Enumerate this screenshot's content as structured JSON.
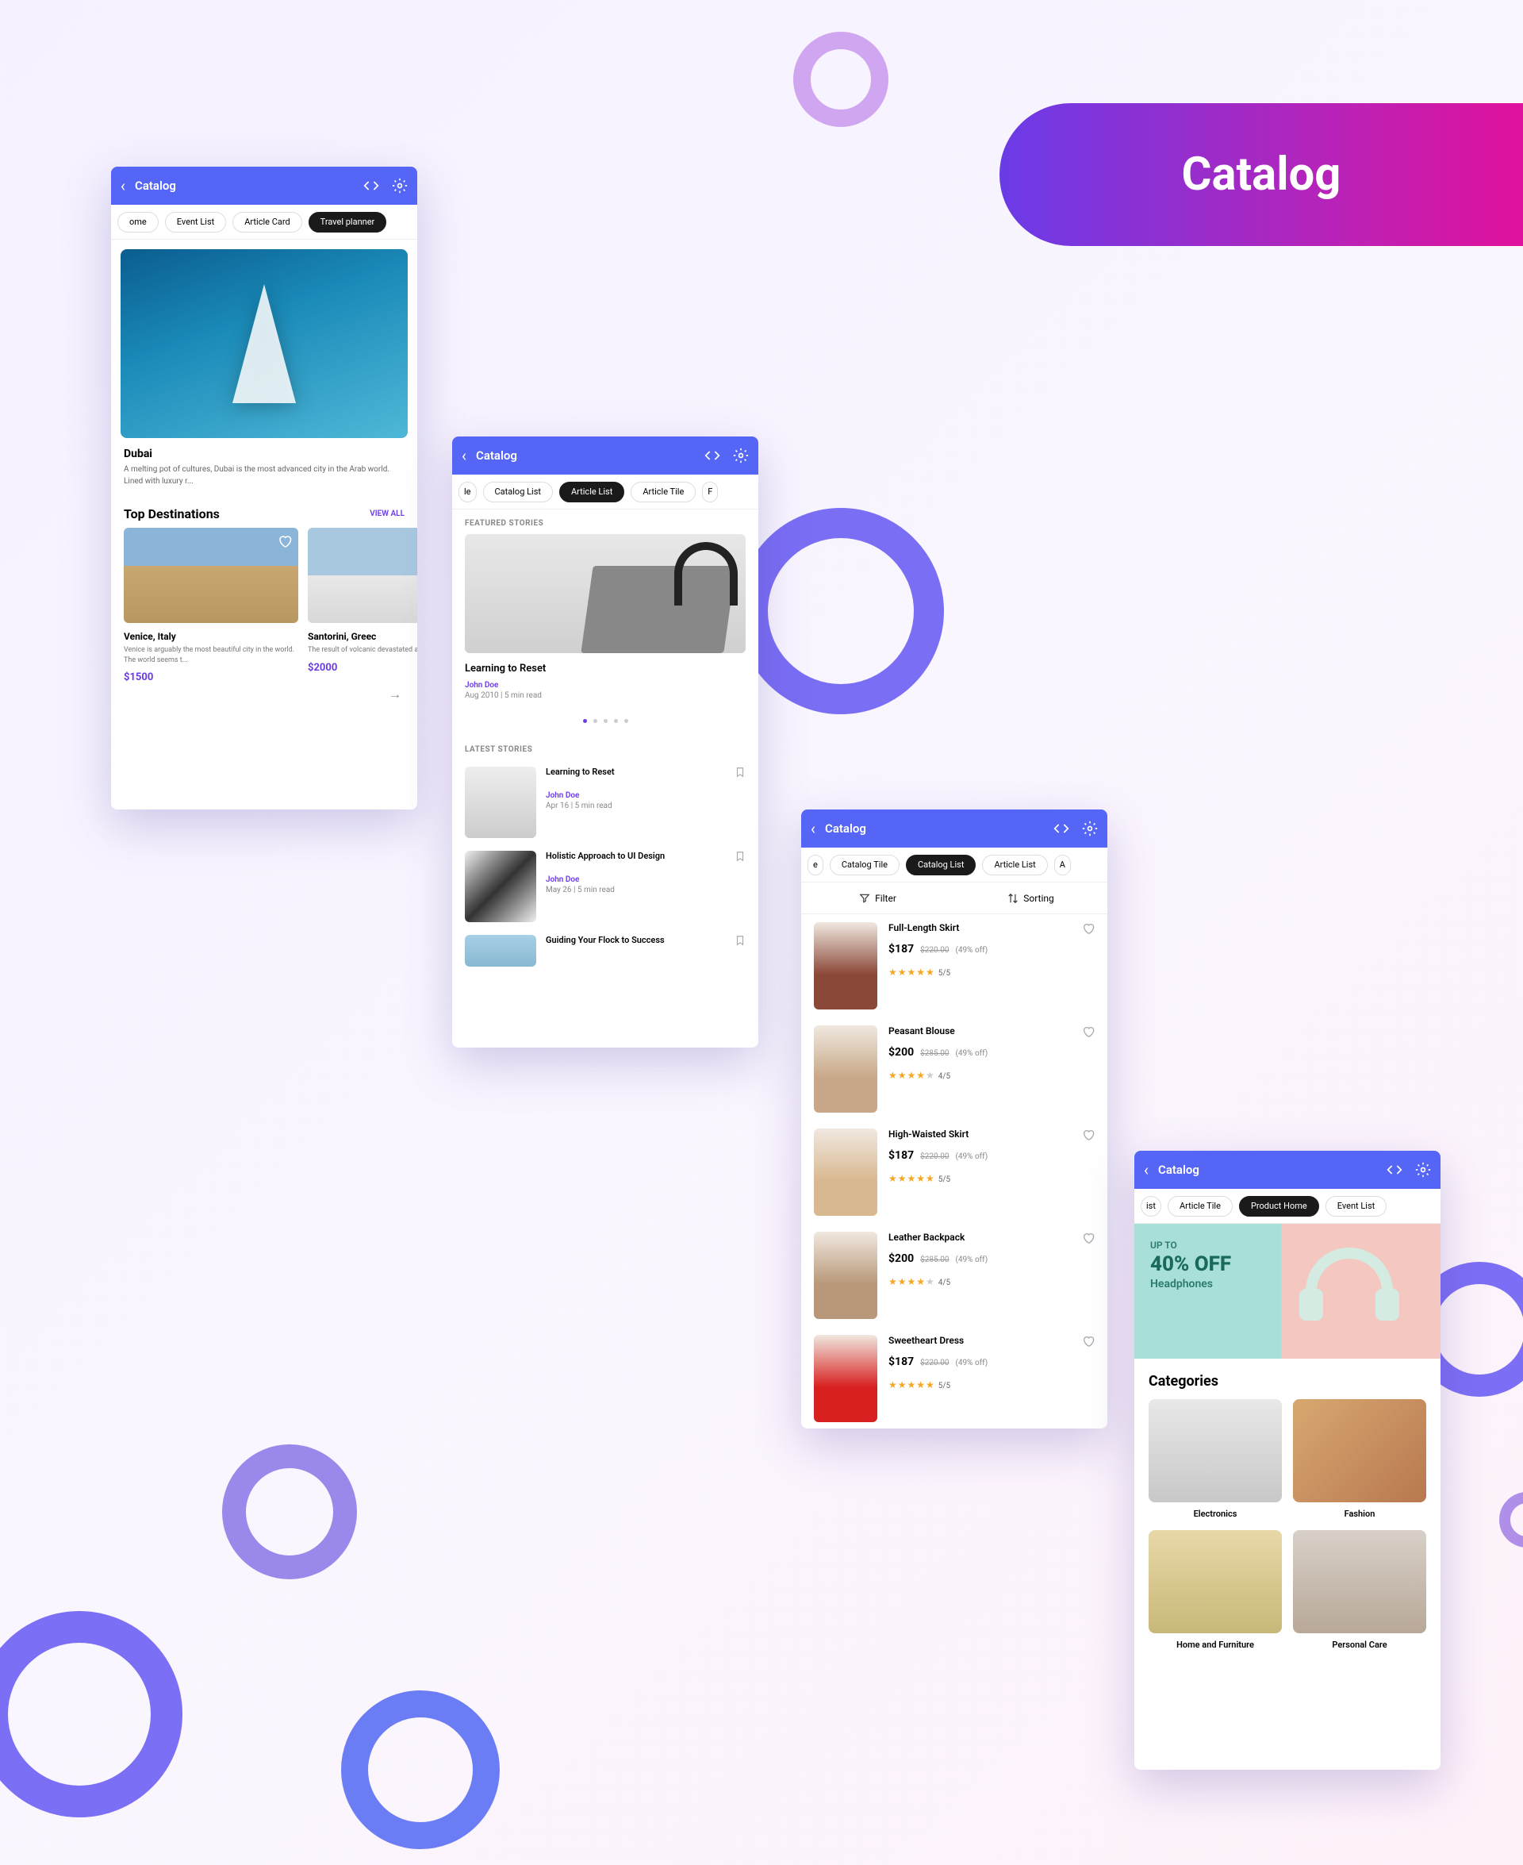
{
  "banner_title": "Catalog",
  "header_title": "Catalog",
  "phone1": {
    "tabs": [
      "ome",
      "Event List",
      "Article Card",
      "Travel planner"
    ],
    "active_tab": 3,
    "hero": {
      "title": "Dubai",
      "desc": "A melting pot of cultures, Dubai is the most advanced city in the Arab world. Lined with luxury r..."
    },
    "section_title": "Top Destinations",
    "view_all": "VIEW ALL",
    "destinations": [
      {
        "title": "Venice, Italy",
        "desc": "Venice is arguably the most beautiful city in the world. The world seems t...",
        "price": "$1500"
      },
      {
        "title": "Santorini, Greec",
        "desc": "The result of volcanic devastated ancient c...",
        "price": "$2000"
      }
    ]
  },
  "phone2": {
    "tabs": [
      "le",
      "Catalog List",
      "Article List",
      "Article Tile",
      "F"
    ],
    "active_tab": 2,
    "featured_label": "FEATURED STORIES",
    "featured": {
      "title": "Learning to Reset",
      "author": "John Doe",
      "meta": "Aug 2010 | 5 min read"
    },
    "latest_label": "LATEST STORIES",
    "stories": [
      {
        "title": "Learning to Reset",
        "author": "John Doe",
        "meta": "Apr 16 | 5 min read"
      },
      {
        "title": "Holistic Approach to UI Design",
        "author": "John Doe",
        "meta": "May 26 | 5 min read"
      },
      {
        "title": "Guiding Your Flock to Success",
        "author": "",
        "meta": ""
      }
    ]
  },
  "phone3": {
    "tabs": [
      "e",
      "Catalog Tile",
      "Catalog List",
      "Article List",
      "A"
    ],
    "active_tab": 2,
    "filter_label": "Filter",
    "sort_label": "Sorting",
    "products": [
      {
        "title": "Full-Length Skirt",
        "price": "$187",
        "was": "$220.00",
        "off": "(49% off)",
        "stars": 5,
        "rating": "5/5"
      },
      {
        "title": "Peasant Blouse",
        "price": "$200",
        "was": "$285.00",
        "off": "(49% off)",
        "stars": 4,
        "rating": "4/5"
      },
      {
        "title": "High-Waisted Skirt",
        "price": "$187",
        "was": "$220.00",
        "off": "(49% off)",
        "stars": 5,
        "rating": "5/5"
      },
      {
        "title": "Leather Backpack",
        "price": "$200",
        "was": "$285.00",
        "off": "(49% off)",
        "stars": 4,
        "rating": "4/5"
      },
      {
        "title": "Sweetheart Dress",
        "price": "$187",
        "was": "$220.00",
        "off": "(49% off)",
        "stars": 5,
        "rating": "5/5"
      }
    ]
  },
  "phone4": {
    "tabs": [
      "ist",
      "Article Tile",
      "Product Home",
      "Event List"
    ],
    "active_tab": 2,
    "promo": {
      "up": "UP TO",
      "off": "40% OFF",
      "cat": "Headphones"
    },
    "cat_title": "Categories",
    "categories": [
      "Electronics",
      "Fashion",
      "Home and Furniture",
      "Personal Care"
    ]
  }
}
